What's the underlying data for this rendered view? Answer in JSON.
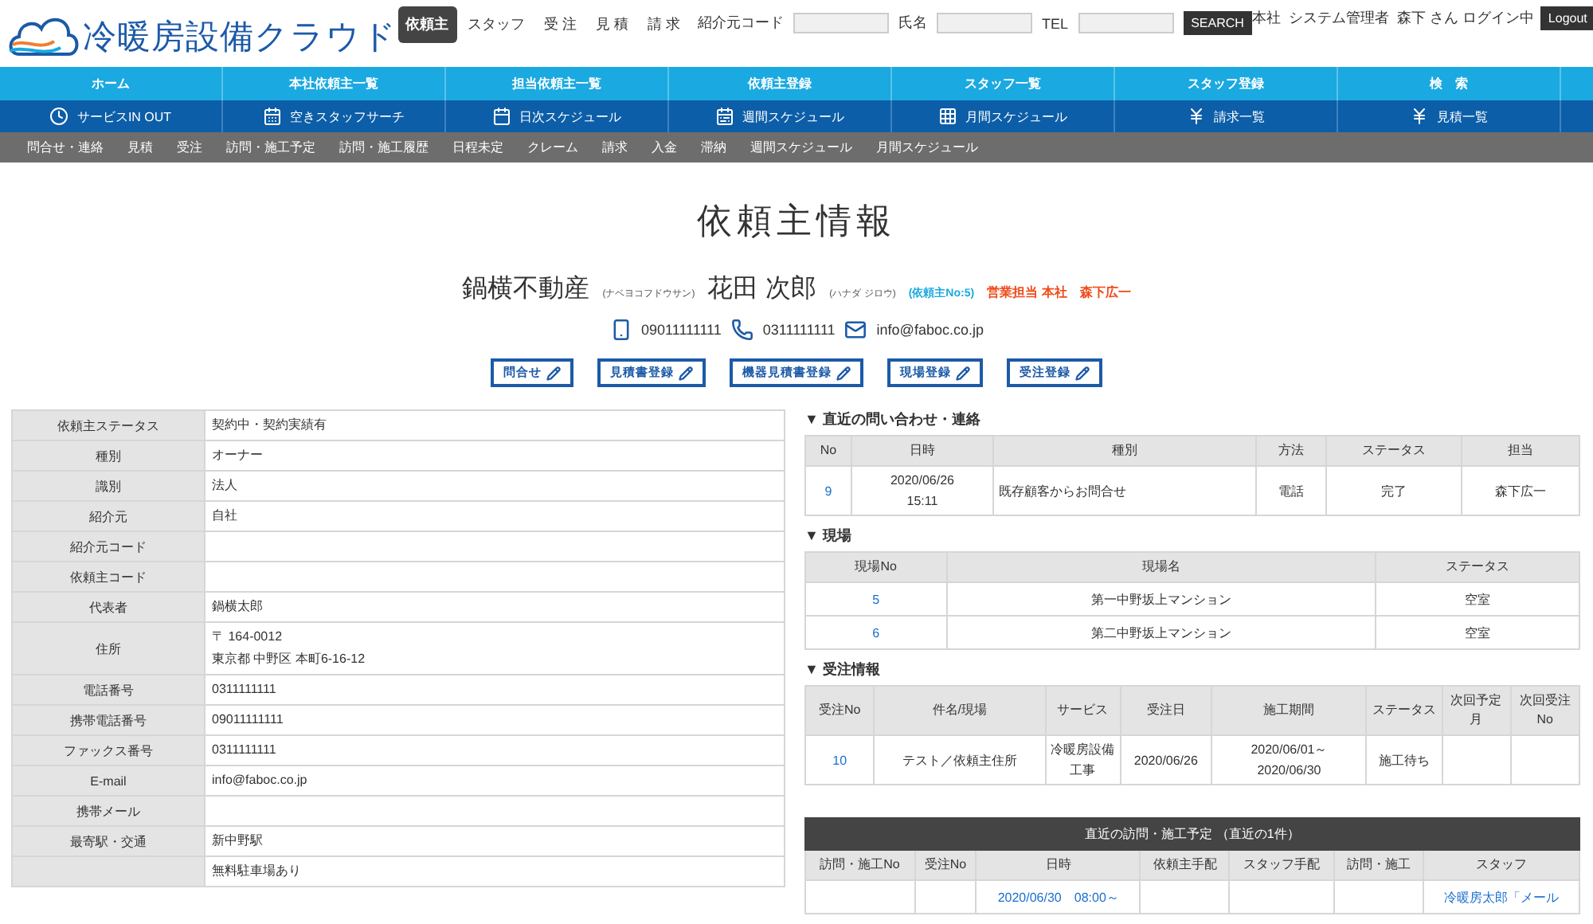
{
  "header": {
    "logo_text": "冷暖房設備クラウド",
    "tabs": [
      {
        "label": "依頼主",
        "selected": true
      },
      {
        "label": "スタッフ",
        "selected": false
      },
      {
        "label": "受 注",
        "selected": false
      },
      {
        "label": "見 積",
        "selected": false
      },
      {
        "label": "請 求",
        "selected": false
      }
    ],
    "search_fields": [
      {
        "label": "紹介元コード"
      },
      {
        "label": "氏名"
      },
      {
        "label": "TEL"
      }
    ],
    "search_button": "SEARCH",
    "user_text": "本社  システム管理者  森下 さん ログイン中",
    "logout": "Logout"
  },
  "nav_main": [
    "ホーム",
    "本社依頼主一覧",
    "担当依頼主一覧",
    "依頼主登録",
    "スタッフ一覧",
    "スタッフ登録",
    "検　索"
  ],
  "nav_sub": [
    {
      "label": "サービスIN OUT",
      "kind": "clock"
    },
    {
      "label": "空きスタッフサーチ",
      "kind": "calendar"
    },
    {
      "label": "日次スケジュール",
      "kind": "day"
    },
    {
      "label": "週間スケジュール",
      "kind": "week"
    },
    {
      "label": "月間スケジュール",
      "kind": "month"
    },
    {
      "label": "請求一覧",
      "kind": "yen"
    },
    {
      "label": "見積一覧",
      "kind": "yen"
    }
  ],
  "nav_links": [
    "問合せ・連絡",
    "見積",
    "受注",
    "訪問・施工予定",
    "訪問・施工履歴",
    "日程未定",
    "クレーム",
    "請求",
    "入金",
    "滞納",
    "週間スケジュール",
    "月間スケジュール"
  ],
  "page_title": "依頼主情報",
  "client": {
    "company": "鍋横不動産",
    "company_kana": "(ナベヨコフドウサン)",
    "name": "花田 次郎",
    "name_kana": "(ハナダ ジロウ)",
    "client_no": "(依頼主No:5)",
    "sales_rep": "営業担当 本社　森下広一"
  },
  "contacts": [
    {
      "kind": "mobile",
      "text": "09011111111"
    },
    {
      "kind": "phone",
      "text": "0311111111"
    },
    {
      "kind": "mail",
      "text": "info@faboc.co.jp"
    }
  ],
  "action_buttons": [
    "問合せ",
    "見積書登録",
    "機器見積書登録",
    "現場登録",
    "受注登録"
  ],
  "detail_rows": [
    {
      "label": "依頼主ステータス",
      "lines": [
        "契約中・契約実績有"
      ]
    },
    {
      "label": "種別",
      "lines": [
        "オーナー"
      ]
    },
    {
      "label": "識別",
      "lines": [
        "法人"
      ]
    },
    {
      "label": "紹介元",
      "lines": [
        "自社"
      ]
    },
    {
      "label": "紹介元コード",
      "lines": []
    },
    {
      "label": "依頼主コード",
      "lines": []
    },
    {
      "label": "代表者",
      "lines": [
        "鍋横太郎"
      ]
    },
    {
      "label": "住所",
      "lines": [
        "〒 164-0012",
        "東京都 中野区 本町6-16-12"
      ]
    },
    {
      "label": "電話番号",
      "lines": [
        "0311111111"
      ]
    },
    {
      "label": "携帯電話番号",
      "lines": [
        "09011111111"
      ]
    },
    {
      "label": "ファックス番号",
      "lines": [
        "0311111111"
      ]
    },
    {
      "label": "E-mail",
      "lines": [
        "info@faboc.co.jp"
      ]
    },
    {
      "label": "携帯メール",
      "lines": []
    },
    {
      "label": "最寄駅・交通",
      "lines": [
        "新中野駅"
      ]
    },
    {
      "lines": [
        "無料駐車場あり"
      ]
    }
  ],
  "inquiries": {
    "title": "▼ 直近の問い合わせ・連絡",
    "columns": [
      "No",
      "日時",
      "種別",
      "方法",
      "ステータス",
      "担当"
    ],
    "rows": [
      [
        {
          "text": "9",
          "link": true
        },
        "2020/06/26\n15:11",
        "既存顧客からお問合せ",
        "電話",
        "完了",
        "森下広一"
      ]
    ]
  },
  "sites": {
    "title": "▼ 現場",
    "columns": [
      "現場No",
      "現場名",
      "ステータス"
    ],
    "rows": [
      [
        {
          "text": "5",
          "link": true
        },
        "第一中野坂上マンション",
        "空室"
      ],
      [
        {
          "text": "6",
          "link": true
        },
        "第二中野坂上マンション",
        "空室"
      ]
    ]
  },
  "orders": {
    "title": "▼ 受注情報",
    "columns": [
      "受注No",
      "件名/現場",
      "サービス",
      "受注日",
      "施工期間",
      "ステータス",
      "次回予定月",
      "次回受注No"
    ],
    "rows": [
      [
        {
          "text": "10",
          "link": true
        },
        "テスト／依頼主住所",
        "冷暖房設備工事",
        "2020/06/26",
        "2020/06/01～\n2020/06/30",
        "施工待ち",
        null,
        null
      ]
    ]
  },
  "visits": {
    "title": "直近の訪問・施工予定 （直近の1件）",
    "columns": [
      "訪問・施工No",
      "受注No",
      "日時",
      "依頼主手配",
      "スタッフ手配",
      "訪問・施工",
      "スタッフ"
    ],
    "rows": [
      [
        null,
        null,
        {
          "text": "2020/06/30　08:00～",
          "link": true
        },
        null,
        null,
        null,
        {
          "text": "冷暖房太郎「メール",
          "link": true
        }
      ]
    ]
  }
}
